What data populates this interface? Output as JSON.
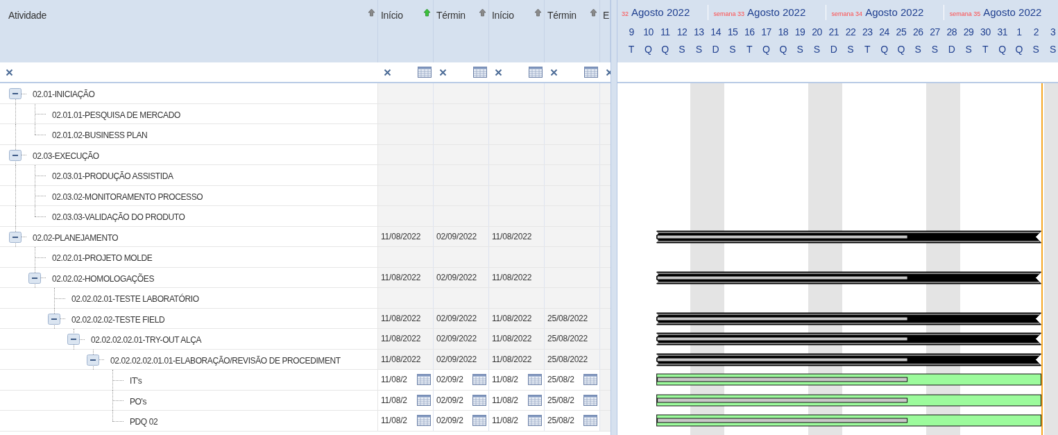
{
  "columns": [
    {
      "label": "Atividade",
      "sorted": false
    },
    {
      "label": "Início",
      "sorted": true
    },
    {
      "label": "Términ",
      "sorted": false
    },
    {
      "label": "Início",
      "sorted": false
    },
    {
      "label": "Términ",
      "sorted": false
    },
    {
      "label": "E"
    }
  ],
  "timeline": {
    "weeks": [
      {
        "week": "32",
        "month": "Agosto 2022"
      },
      {
        "week": "semana 33",
        "month": "Agosto 2022"
      },
      {
        "week": "semana 34",
        "month": "Agosto 2022"
      },
      {
        "week": "semana 35",
        "month": "Agosto 2022"
      }
    ],
    "days": [
      {
        "day": "9",
        "weekday": "T",
        "weekend": false
      },
      {
        "day": "10",
        "weekday": "Q",
        "weekend": false
      },
      {
        "day": "11",
        "weekday": "Q",
        "weekend": false
      },
      {
        "day": "12",
        "weekday": "S",
        "weekend": false
      },
      {
        "day": "13",
        "weekday": "S",
        "weekend": true
      },
      {
        "day": "14",
        "weekday": "D",
        "weekend": true
      },
      {
        "day": "15",
        "weekday": "S",
        "weekend": false
      },
      {
        "day": "16",
        "weekday": "T",
        "weekend": false
      },
      {
        "day": "17",
        "weekday": "Q",
        "weekend": false
      },
      {
        "day": "18",
        "weekday": "Q",
        "weekend": false
      },
      {
        "day": "19",
        "weekday": "S",
        "weekend": false
      },
      {
        "day": "20",
        "weekday": "S",
        "weekend": true
      },
      {
        "day": "21",
        "weekday": "D",
        "weekend": true
      },
      {
        "day": "22",
        "weekday": "S",
        "weekend": false
      },
      {
        "day": "23",
        "weekday": "T",
        "weekend": false
      },
      {
        "day": "24",
        "weekday": "Q",
        "weekend": false
      },
      {
        "day": "25",
        "weekday": "Q",
        "weekend": false
      },
      {
        "day": "26",
        "weekday": "S",
        "weekend": false
      },
      {
        "day": "27",
        "weekday": "S",
        "weekend": true
      },
      {
        "day": "28",
        "weekday": "D",
        "weekend": true
      },
      {
        "day": "29",
        "weekday": "S",
        "weekend": false
      },
      {
        "day": "30",
        "weekday": "T",
        "weekend": false
      },
      {
        "day": "31",
        "weekday": "Q",
        "weekend": false
      },
      {
        "day": "1",
        "weekday": "Q",
        "weekend": false
      },
      {
        "day": "2",
        "weekday": "S",
        "weekend": false
      },
      {
        "day": "3",
        "weekday": "S",
        "weekend": true
      }
    ]
  },
  "tasks": [
    {
      "label": "02.01-INICIAÇÃO",
      "expanded": true,
      "children": [
        {
          "label": "02.01.01-PESQUISA DE MERCADO"
        },
        {
          "label": "02.01.02-BUSINESS PLAN"
        }
      ]
    },
    {
      "label": "02.03-EXECUÇÃO",
      "expanded": true,
      "children": [
        {
          "label": "02.03.01-PRODUÇÃO ASSISTIDA"
        },
        {
          "label": "02.03.02-MONITORAMENTO PROCESSO"
        },
        {
          "label": "02.03.03-VALIDAÇÃO DO PRODUTO"
        }
      ]
    },
    {
      "label": "02.02-PLANEJAMENTO",
      "expanded": true,
      "dates": [
        "11/08/2022",
        "02/09/2022",
        "11/08/2022"
      ],
      "bar": {
        "kind": "summary",
        "level": 0.65
      },
      "children": [
        {
          "label": "02.02.01-PROJETO MOLDE"
        },
        {
          "label": "02.02.02-HOMOLOGAÇÕES",
          "expanded": true,
          "dates": [
            "11/08/2022",
            "02/09/2022",
            "11/08/2022"
          ],
          "bar": {
            "kind": "summary",
            "level": 0.65
          },
          "children": [
            {
              "label": "02.02.02.01-TESTE LABORATÓRIO"
            },
            {
              "label": "02.02.02.02-TESTE FIELD",
              "expanded": true,
              "dates": [
                "11/08/2022",
                "02/09/2022",
                "11/08/2022",
                "25/08/2022"
              ],
              "bar": {
                "kind": "summary",
                "level": 0.65
              },
              "children": [
                {
                  "label": "02.02.02.02.01-TRY-OUT ALÇA",
                  "expanded": true,
                  "dates": [
                    "11/08/2022",
                    "02/09/2022",
                    "11/08/2022",
                    "25/08/2022"
                  ],
                  "bar": {
                    "kind": "summary",
                    "level": 0.65
                  },
                  "children": [
                    {
                      "label": "02.02.02.02.01.01-ELABORAÇÃO/REVISÃO DE PROCEDIMENT",
                      "expanded": true,
                      "dates": [
                        "11/08/2022",
                        "02/09/2022",
                        "11/08/2022",
                        "25/08/2022"
                      ],
                      "bar": {
                        "kind": "summary",
                        "level": 0.65
                      },
                      "children": [
                        {
                          "label": "IT's",
                          "editable": true,
                          "dates": [
                            "11/08/2",
                            "02/09/2",
                            "11/08/2",
                            "25/08/2"
                          ],
                          "bar": {
                            "kind": "task",
                            "level": 0.65
                          }
                        },
                        {
                          "label": "PO's",
                          "editable": true,
                          "dates": [
                            "11/08/2",
                            "02/09/2",
                            "11/08/2",
                            "25/08/2"
                          ],
                          "bar": {
                            "kind": "task",
                            "level": 0.65
                          }
                        },
                        {
                          "label": "PDQ 02",
                          "editable": true,
                          "dates": [
                            "11/08/2",
                            "02/09/2",
                            "11/08/2",
                            "25/08/2"
                          ],
                          "bar": {
                            "kind": "task",
                            "level": 0.65
                          }
                        }
                      ]
                    }
                  ]
                }
              ]
            }
          ]
        }
      ]
    }
  ]
}
